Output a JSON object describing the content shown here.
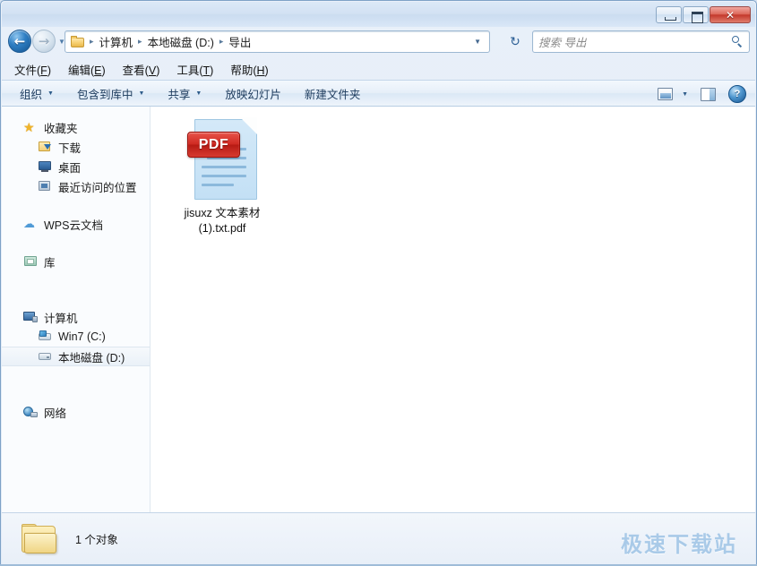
{
  "window": {
    "controls": {
      "minimize_label": "最小化",
      "maximize_label": "最大化",
      "close_label": "✕"
    }
  },
  "navigation": {
    "back_label": "←",
    "forward_label": "→",
    "history_caret": "▼",
    "address": {
      "crumbs": [
        "计算机",
        "本地磁盘 (D:)",
        "导出"
      ],
      "separator": "▸",
      "dropdown_caret": "▼"
    },
    "refresh_label": "↻",
    "search": {
      "placeholder": "搜索 导出",
      "value": ""
    }
  },
  "menubar": {
    "items": [
      {
        "pre": "文件(",
        "key": "F",
        "post": ")"
      },
      {
        "pre": "编辑(",
        "key": "E",
        "post": ")"
      },
      {
        "pre": "查看(",
        "key": "V",
        "post": ")"
      },
      {
        "pre": "工具(",
        "key": "T",
        "post": ")"
      },
      {
        "pre": "帮助(",
        "key": "H",
        "post": ")"
      }
    ]
  },
  "toolbar": {
    "items": [
      {
        "label": "组织",
        "caret": "▼"
      },
      {
        "label": "包含到库中",
        "caret": "▼"
      },
      {
        "label": "共享",
        "caret": "▼"
      },
      {
        "label": "放映幻灯片",
        "caret": ""
      },
      {
        "label": "新建文件夹",
        "caret": ""
      }
    ],
    "view_caret": "▼",
    "help_glyph": "?"
  },
  "sidebar": {
    "groups": [
      {
        "header": {
          "label": "收藏夹",
          "icon": "star-icon"
        },
        "children": [
          {
            "label": "下载",
            "icon": "download-folder-icon"
          },
          {
            "label": "桌面",
            "icon": "desktop-icon"
          },
          {
            "label": "最近访问的位置",
            "icon": "recent-places-icon"
          }
        ]
      },
      {
        "header": {
          "label": "WPS云文档",
          "icon": "cloud-icon"
        },
        "children": []
      },
      {
        "header": {
          "label": "库",
          "icon": "library-icon"
        },
        "children": []
      },
      {
        "header": {
          "label": "计算机",
          "icon": "computer-icon"
        },
        "children": [
          {
            "label": "Win7 (C:)",
            "icon": "system-drive-icon"
          },
          {
            "label": "本地磁盘 (D:)",
            "icon": "drive-icon",
            "selected": true
          }
        ]
      },
      {
        "header": {
          "label": "网络",
          "icon": "network-icon"
        },
        "children": []
      }
    ]
  },
  "content": {
    "files": [
      {
        "name": "jisuxz 文本素材 (1).txt.pdf",
        "icon": "pdf-file-icon",
        "badge": "PDF"
      }
    ]
  },
  "statusbar": {
    "folder_icon": "folder-icon",
    "item_count_text": "1 个对象",
    "watermark": "极速下载站"
  }
}
